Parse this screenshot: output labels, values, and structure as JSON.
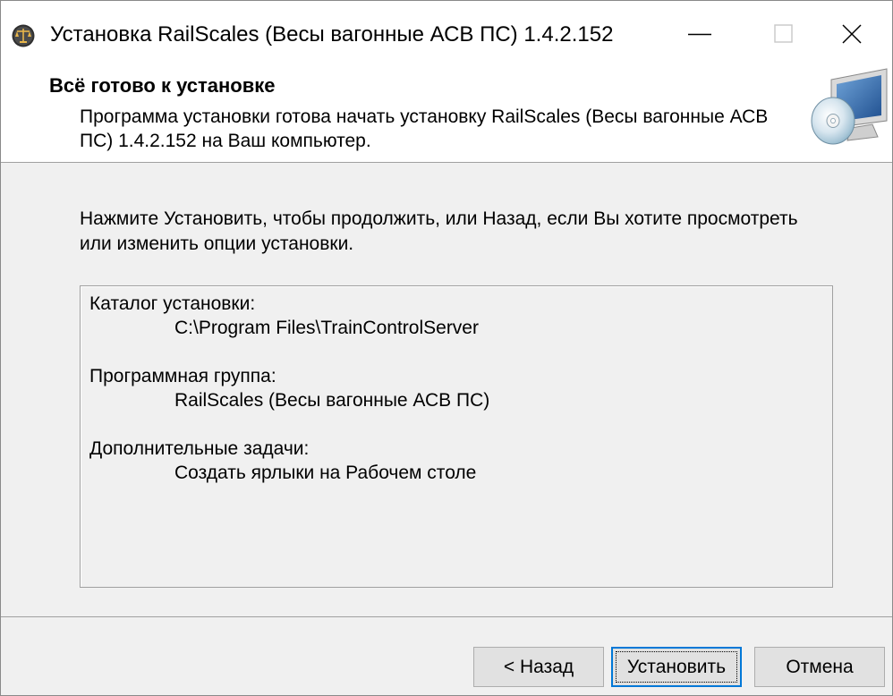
{
  "window": {
    "title": "Установка RailScales (Весы вагонные АСВ ПС) 1.4.2.152",
    "app_icon": "scales-icon",
    "controls": {
      "minimize_icon": "minimize-icon",
      "maximize_icon": "maximize-icon",
      "close_icon": "close-icon"
    }
  },
  "header": {
    "title": "Всё готово к установке",
    "subtitle": "Программа установки готова начать установку RailScales (Весы вагонные АСВ ПС) 1.4.2.152 на Ваш компьютер.",
    "image_icon": "computer-cd-icon"
  },
  "body": {
    "instruction": "Нажмите Установить, чтобы продолжить, или Назад, если Вы хотите просмотреть или изменить опции установки.",
    "summary": [
      {
        "label": "Каталог установки:",
        "value": "C:\\Program Files\\TrainControlServer"
      },
      {
        "label": "Программная группа:",
        "value": "RailScales (Весы вагонные АСВ ПС)"
      },
      {
        "label": "Дополнительные задачи:",
        "value": "Создать ярлыки на Рабочем столе"
      }
    ]
  },
  "buttons": {
    "back": "< Назад",
    "install": "Установить",
    "cancel": "Отмена"
  },
  "colors": {
    "focus_border": "#0078d7",
    "panel_background": "#f0f0f0",
    "button_background": "#e1e1e1"
  }
}
